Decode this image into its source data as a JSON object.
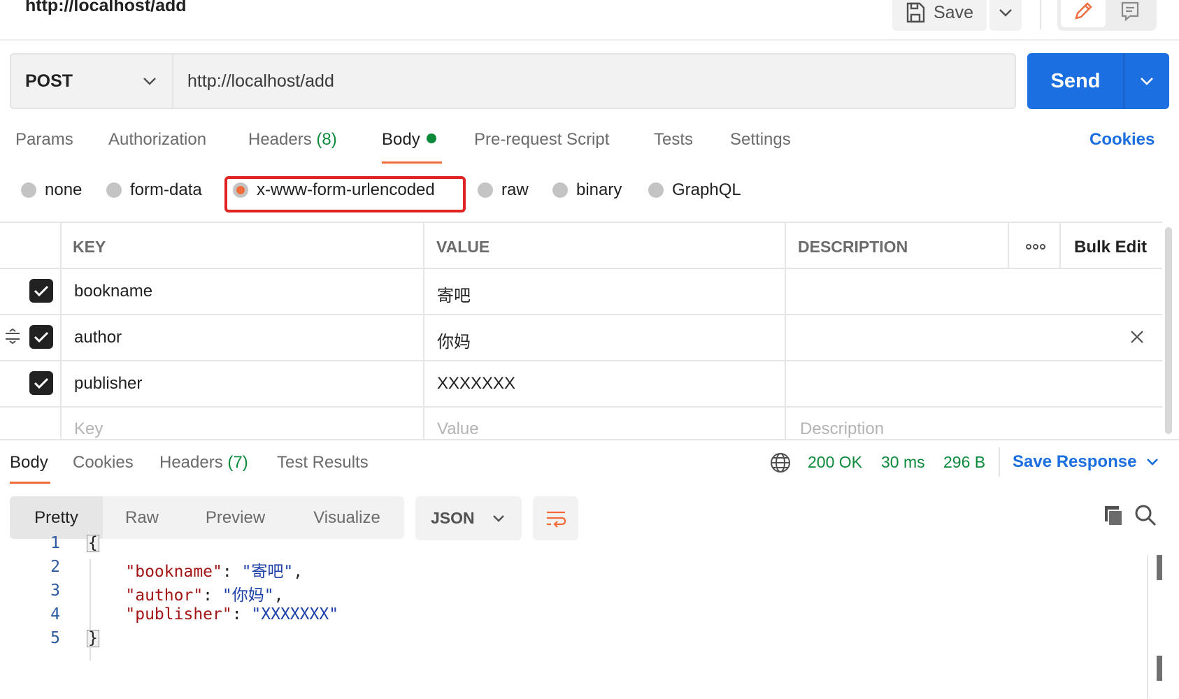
{
  "header": {
    "title": "http://localhost/add",
    "save_label": "Save"
  },
  "request": {
    "method": "POST",
    "url": "http://localhost/add",
    "send_label": "Send"
  },
  "request_tabs": [
    {
      "label": "Params"
    },
    {
      "label": "Authorization"
    },
    {
      "label": "Headers",
      "count": "(8)"
    },
    {
      "label": "Body"
    },
    {
      "label": "Pre-request Script"
    },
    {
      "label": "Tests"
    },
    {
      "label": "Settings"
    }
  ],
  "cookies_label": "Cookies",
  "body_types": [
    {
      "label": "none"
    },
    {
      "label": "form-data"
    },
    {
      "label": "x-www-form-urlencoded",
      "selected": true
    },
    {
      "label": "raw"
    },
    {
      "label": "binary"
    },
    {
      "label": "GraphQL"
    }
  ],
  "params_table": {
    "headers": {
      "key": "KEY",
      "value": "VALUE",
      "description": "DESCRIPTION",
      "bulk_edit": "Bulk Edit"
    },
    "rows": [
      {
        "checked": true,
        "key": "bookname",
        "value": "寄吧",
        "description": ""
      },
      {
        "checked": true,
        "key": "author",
        "value": "你妈",
        "description": ""
      },
      {
        "checked": true,
        "key": "publisher",
        "value": "XXXXXXX",
        "description": ""
      }
    ],
    "placeholders": {
      "key": "Key",
      "value": "Value",
      "description": "Description"
    }
  },
  "response": {
    "tabs": [
      {
        "label": "Body"
      },
      {
        "label": "Cookies"
      },
      {
        "label": "Headers",
        "count": "(7)"
      },
      {
        "label": "Test Results"
      }
    ],
    "status": "200 OK",
    "time": "30 ms",
    "size": "296 B",
    "save_response_label": "Save Response",
    "view_modes": [
      {
        "label": "Pretty"
      },
      {
        "label": "Raw"
      },
      {
        "label": "Preview"
      },
      {
        "label": "Visualize"
      }
    ],
    "format": "JSON",
    "code_lines": [
      {
        "n": "1",
        "open": "{"
      },
      {
        "n": "2",
        "key": "\"bookname\"",
        "value": "\"寄吧\"",
        "sep": ": ",
        "end": ","
      },
      {
        "n": "3",
        "key": "\"author\"",
        "value": "\"你妈\"",
        "sep": ": ",
        "end": ","
      },
      {
        "n": "4",
        "key": "\"publisher\"",
        "value": "\"XXXXXXX\"",
        "sep": ": ",
        "end": ""
      },
      {
        "n": "5",
        "close": "}"
      }
    ]
  },
  "icons": [
    "save-icon",
    "chevron-down-icon",
    "pencil-icon",
    "document-icon",
    "drag-handle-icon",
    "checkmark-icon",
    "close-icon",
    "more-options-icon",
    "globe-icon",
    "wrap-lines-icon",
    "copy-icon",
    "search-icon"
  ],
  "colors": {
    "accent": "#f26b3a",
    "primary": "#1c6fe0",
    "success": "#0b8a3a",
    "highlight": "#e02424",
    "json_key": "#a31515",
    "json_string": "#1c3fa8"
  }
}
